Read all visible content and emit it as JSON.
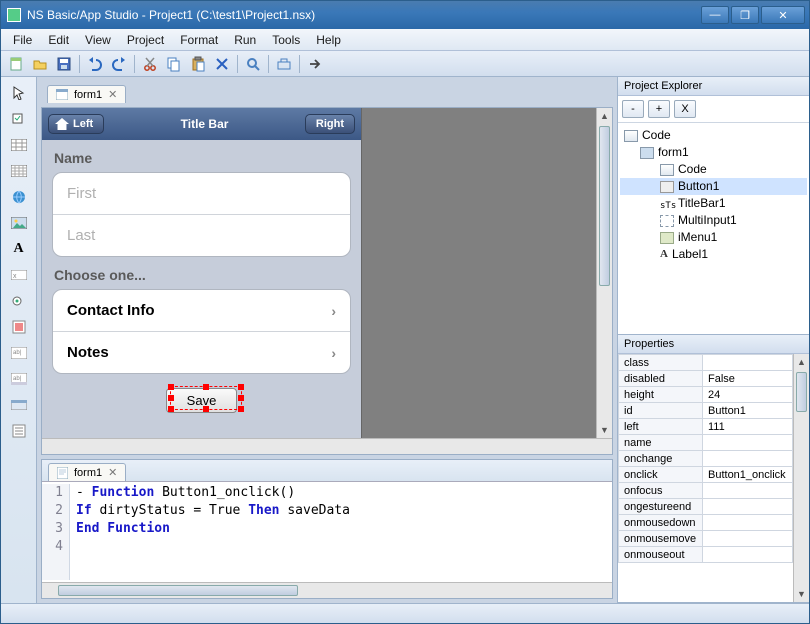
{
  "window": {
    "title": "NS Basic/App Studio - Project1 (C:\\test1\\Project1.nsx)"
  },
  "menu": [
    "File",
    "Edit",
    "View",
    "Project",
    "Format",
    "Run",
    "Tools",
    "Help"
  ],
  "designer": {
    "tab_label": "form1",
    "titlebar": {
      "left": "Left",
      "center": "Title Bar",
      "right": "Right"
    },
    "name_label": "Name",
    "first_placeholder": "First",
    "last_placeholder": "Last",
    "choose_label": "Choose one...",
    "menu_items": [
      "Contact Info",
      "Notes"
    ],
    "save_label": "Save"
  },
  "code": {
    "tab_label": "form1",
    "lines": [
      {
        "n": 1,
        "prefix": "- ",
        "tokens": [
          [
            "kw",
            "Function"
          ],
          [
            "",
            " Button1_onclick()"
          ]
        ]
      },
      {
        "n": 2,
        "prefix": "  ",
        "tokens": [
          [
            "",
            "  "
          ],
          [
            "kw",
            "If"
          ],
          [
            "",
            " dirtyStatus = True "
          ],
          [
            "kw",
            "Then"
          ],
          [
            "",
            " saveData"
          ]
        ]
      },
      {
        "n": 3,
        "prefix": "  ",
        "tokens": [
          [
            "kw",
            "End Function"
          ]
        ]
      },
      {
        "n": 4,
        "prefix": "  ",
        "tokens": []
      }
    ]
  },
  "project_explorer": {
    "title": "Project Explorer",
    "buttons": [
      "-",
      "+",
      "X"
    ],
    "tree": [
      {
        "level": 0,
        "icon": "code",
        "label": "Code"
      },
      {
        "level": 1,
        "icon": "form",
        "label": "form1"
      },
      {
        "level": 2,
        "icon": "code",
        "label": "Code"
      },
      {
        "level": 2,
        "icon": "btn",
        "label": "Button1",
        "selected": true
      },
      {
        "level": 2,
        "icon": "title",
        "label": "TitleBar1"
      },
      {
        "level": 2,
        "icon": "multi",
        "label": "MultiInput1"
      },
      {
        "level": 2,
        "icon": "menu",
        "label": "iMenu1"
      },
      {
        "level": 2,
        "icon": "label",
        "label": "Label1"
      }
    ]
  },
  "properties": {
    "title": "Properties",
    "rows": [
      [
        "class",
        ""
      ],
      [
        "disabled",
        "False"
      ],
      [
        "height",
        "24"
      ],
      [
        "id",
        "Button1"
      ],
      [
        "left",
        "111"
      ],
      [
        "name",
        ""
      ],
      [
        "onchange",
        ""
      ],
      [
        "onclick",
        "Button1_onclick"
      ],
      [
        "onfocus",
        ""
      ],
      [
        "ongestureend",
        ""
      ],
      [
        "onmousedown",
        ""
      ],
      [
        "onmousemove",
        ""
      ],
      [
        "onmouseout",
        ""
      ]
    ]
  }
}
